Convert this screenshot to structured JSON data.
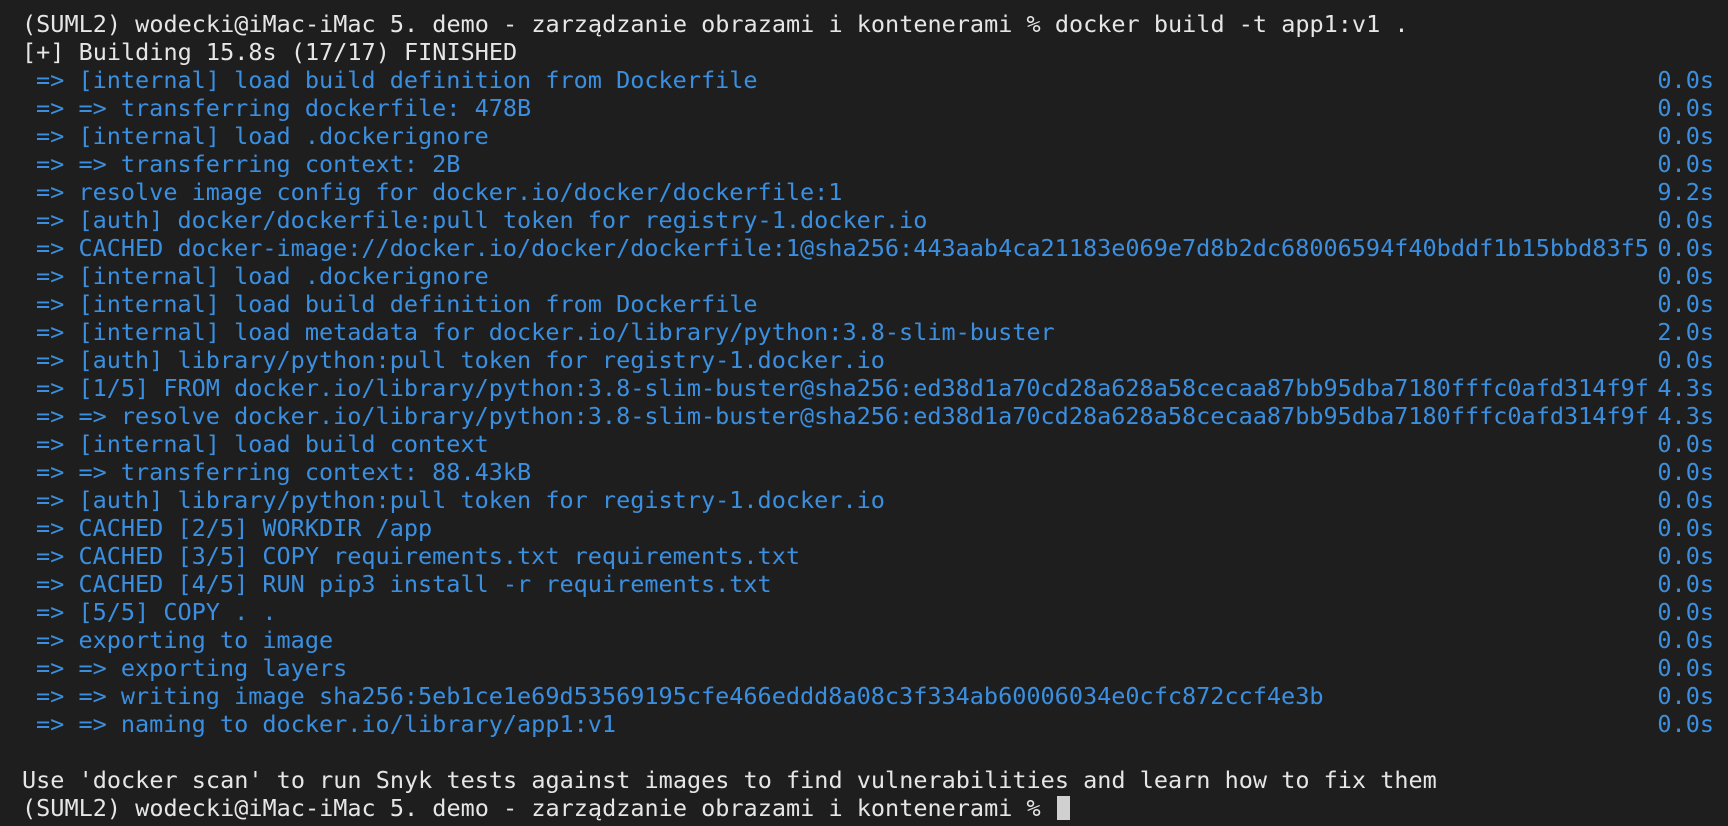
{
  "colors": {
    "background": "#1e1e1e",
    "plain_text": "#e6e6e6",
    "build_step": "#3b8fe0",
    "cursor": "#d0d0d0"
  },
  "prompt_line": "(SUML2) wodecki@iMac-iMac 5. demo - zarządzanie obrazami i kontenerami % docker build -t app1:v1 .",
  "build_status": "[+] Building 15.8s (17/17) FINISHED",
  "steps": [
    {
      "text": "=> [internal] load build definition from Dockerfile",
      "time": "0.0s"
    },
    {
      "text": "=> => transferring dockerfile: 478B",
      "time": "0.0s"
    },
    {
      "text": "=> [internal] load .dockerignore",
      "time": "0.0s"
    },
    {
      "text": "=> => transferring context: 2B",
      "time": "0.0s"
    },
    {
      "text": "=> resolve image config for docker.io/docker/dockerfile:1",
      "time": "9.2s"
    },
    {
      "text": "=> [auth] docker/dockerfile:pull token for registry-1.docker.io",
      "time": "0.0s"
    },
    {
      "text": "=> CACHED docker-image://docker.io/docker/dockerfile:1@sha256:443aab4ca21183e069e7d8b2dc68006594f40bddf1b15bbd83f5",
      "time": "0.0s"
    },
    {
      "text": "=> [internal] load .dockerignore",
      "time": "0.0s"
    },
    {
      "text": "=> [internal] load build definition from Dockerfile",
      "time": "0.0s"
    },
    {
      "text": "=> [internal] load metadata for docker.io/library/python:3.8-slim-buster",
      "time": "2.0s"
    },
    {
      "text": "=> [auth] library/python:pull token for registry-1.docker.io",
      "time": "0.0s"
    },
    {
      "text": "=> [1/5] FROM docker.io/library/python:3.8-slim-buster@sha256:ed38d1a70cd28a628a58cecaa87bb95dba7180fffc0afd314f9f",
      "time": "4.3s"
    },
    {
      "text": "=> => resolve docker.io/library/python:3.8-slim-buster@sha256:ed38d1a70cd28a628a58cecaa87bb95dba7180fffc0afd314f9f",
      "time": "4.3s"
    },
    {
      "text": "=> [internal] load build context",
      "time": "0.0s"
    },
    {
      "text": "=> => transferring context: 88.43kB",
      "time": "0.0s"
    },
    {
      "text": "=> [auth] library/python:pull token for registry-1.docker.io",
      "time": "0.0s"
    },
    {
      "text": "=> CACHED [2/5] WORKDIR /app",
      "time": "0.0s"
    },
    {
      "text": "=> CACHED [3/5] COPY requirements.txt requirements.txt",
      "time": "0.0s"
    },
    {
      "text": "=> CACHED [4/5] RUN pip3 install -r requirements.txt",
      "time": "0.0s"
    },
    {
      "text": "=> [5/5] COPY . .",
      "time": "0.0s"
    },
    {
      "text": "=> exporting to image",
      "time": "0.0s"
    },
    {
      "text": "=> => exporting layers",
      "time": "0.0s"
    },
    {
      "text": "=> => writing image sha256:5eb1ce1e69d53569195cfe466eddd8a08c3f334ab60006034e0cfc872ccf4e3b",
      "time": "0.0s"
    },
    {
      "text": "=> => naming to docker.io/library/app1:v1",
      "time": "0.0s"
    }
  ],
  "scan_hint": "Use 'docker scan' to run Snyk tests against images to find vulnerabilities and learn how to fix them",
  "final_prompt": "(SUML2) wodecki@iMac-iMac 5. demo - zarządzanie obrazami i kontenerami % "
}
